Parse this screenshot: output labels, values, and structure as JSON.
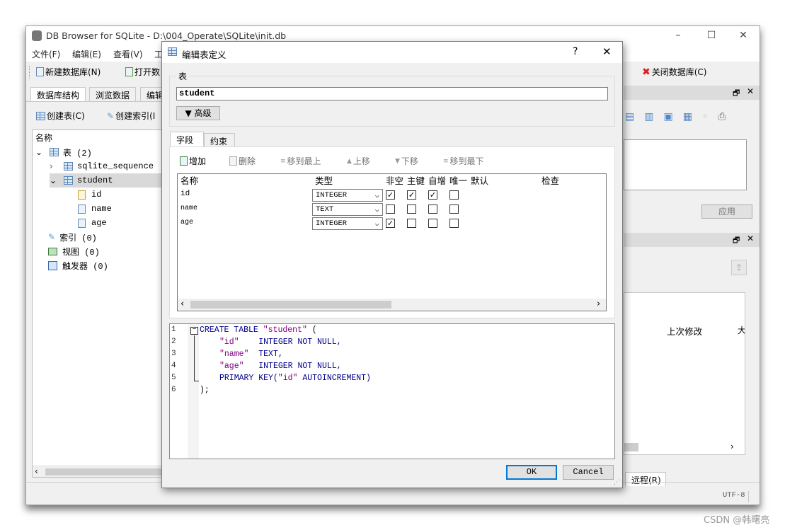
{
  "main_window": {
    "title": "DB Browser for SQLite - D:\\004_Operate\\SQLite\\init.db",
    "menus": [
      "文件(F)",
      "编辑(E)",
      "查看(V)",
      "工"
    ],
    "toolbar": {
      "new_db": "新建数据库(N)",
      "open_db": "打开数",
      "close_db": "关闭数据库(C)"
    },
    "tabs": [
      "数据库结构",
      "浏览数据",
      "编辑"
    ],
    "actions": {
      "create_table": "创建表(C)",
      "create_index": "创建索引(I"
    },
    "tree": {
      "header": "名称",
      "tables_node": "表 (2)",
      "items": {
        "sqlite_sequence": "sqlite_sequence",
        "student": "student",
        "id": "id",
        "name": "name",
        "age": "age"
      },
      "indexes": "索引 (0)",
      "views": "视图 (0)",
      "triggers": "触发器 (0)"
    },
    "right_panel": {
      "apply": "应用",
      "last_modified": "上次修改",
      "last_modified_cut": "大",
      "remote_tab": "远程(R)"
    },
    "status": {
      "encoding": "UTF-8"
    }
  },
  "dialog": {
    "title": "编辑表定义",
    "help": "?",
    "close": "✕",
    "table_group_label": "表",
    "table_name": "student",
    "advanced": "▼ 高级",
    "tabs": [
      "字段",
      "约束"
    ],
    "field_toolbar": {
      "add": "增加",
      "delete": "删除",
      "move_top": "移到最上",
      "move_up": "上移",
      "move_down": "下移",
      "move_bottom": "移到最下"
    },
    "columns": [
      "名称",
      "类型",
      "非空",
      "主键",
      "自增",
      "唯一",
      "默认",
      "检查"
    ],
    "fields": [
      {
        "name": "id",
        "type": "INTEGER",
        "not_null": true,
        "pk": true,
        "ai": true,
        "unique": false
      },
      {
        "name": "name",
        "type": "TEXT",
        "not_null": false,
        "pk": false,
        "ai": false,
        "unique": false
      },
      {
        "name": "age",
        "type": "INTEGER",
        "not_null": true,
        "pk": false,
        "ai": false,
        "unique": false
      }
    ],
    "sql": {
      "line_numbers": [
        "1",
        "2",
        "3",
        "4",
        "5",
        "6"
      ],
      "l1_kw": "CREATE TABLE",
      "l1_str": "\"student\"",
      "l1_tail": " (",
      "l2_col": "\"id\"",
      "l2_rest": "INTEGER NOT NULL,",
      "l3_col": "\"name\"",
      "l3_rest": "TEXT,",
      "l4_col": "\"age\"",
      "l4_rest": "INTEGER NOT NULL,",
      "l5_kw": "PRIMARY KEY(",
      "l5_col": "\"id\"",
      "l5_rest": " AUTOINCREMENT)",
      "l6": ");"
    },
    "ok": "OK",
    "cancel": "Cancel"
  },
  "watermark": "CSDN @韩曙亮"
}
